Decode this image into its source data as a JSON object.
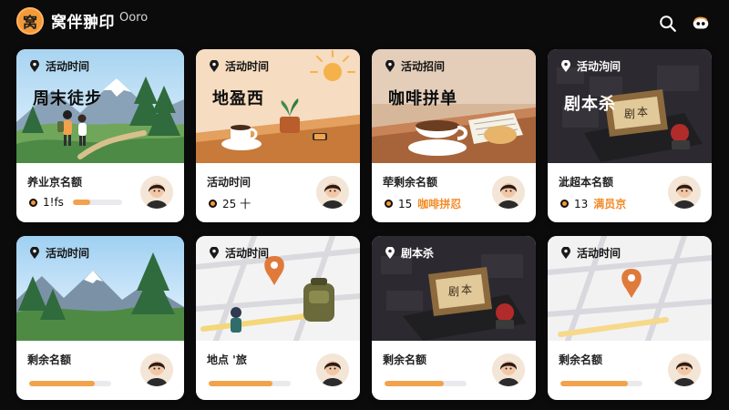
{
  "header": {
    "logo_text": "窝",
    "title": "窝伴翀印",
    "subtitle": "Ooro"
  },
  "icons": {
    "search": "search-icon",
    "profile": "profile-icon",
    "pin": "location-pin-icon"
  },
  "colors": {
    "accent": "#f29a3a",
    "card_bg": "#ffffff",
    "page_bg": "#0b0b0c"
  },
  "cards": [
    {
      "pill": "活动时间",
      "title": "周末徒步",
      "label": "养业京名额",
      "meta_text": "1!fs",
      "progress": 0.35
    },
    {
      "pill": "活动时间",
      "title": "地盈西",
      "label": "活动时间",
      "meta_text": "25 十"
    },
    {
      "pill": "活动招间",
      "title": "咖啡拼单",
      "label": "荦剩余名额",
      "meta_num": "15",
      "meta_orange": "咖啡拼忍"
    },
    {
      "pill": "活动泃间",
      "title": "剧本杀",
      "label": "泚超本名额",
      "meta_num": "13",
      "meta_orange": "满员京"
    },
    {
      "pill": "活动时间",
      "label": "剩余名额",
      "progress": 0.8
    },
    {
      "pill": "活动时间",
      "label": "地点 '旅",
      "progress": 0.78
    },
    {
      "pill": "剧本杀",
      "label": "剩余名额",
      "progress": 0.72
    },
    {
      "pill": "活动时间",
      "label": "剩余名额",
      "progress": 0.82
    }
  ]
}
